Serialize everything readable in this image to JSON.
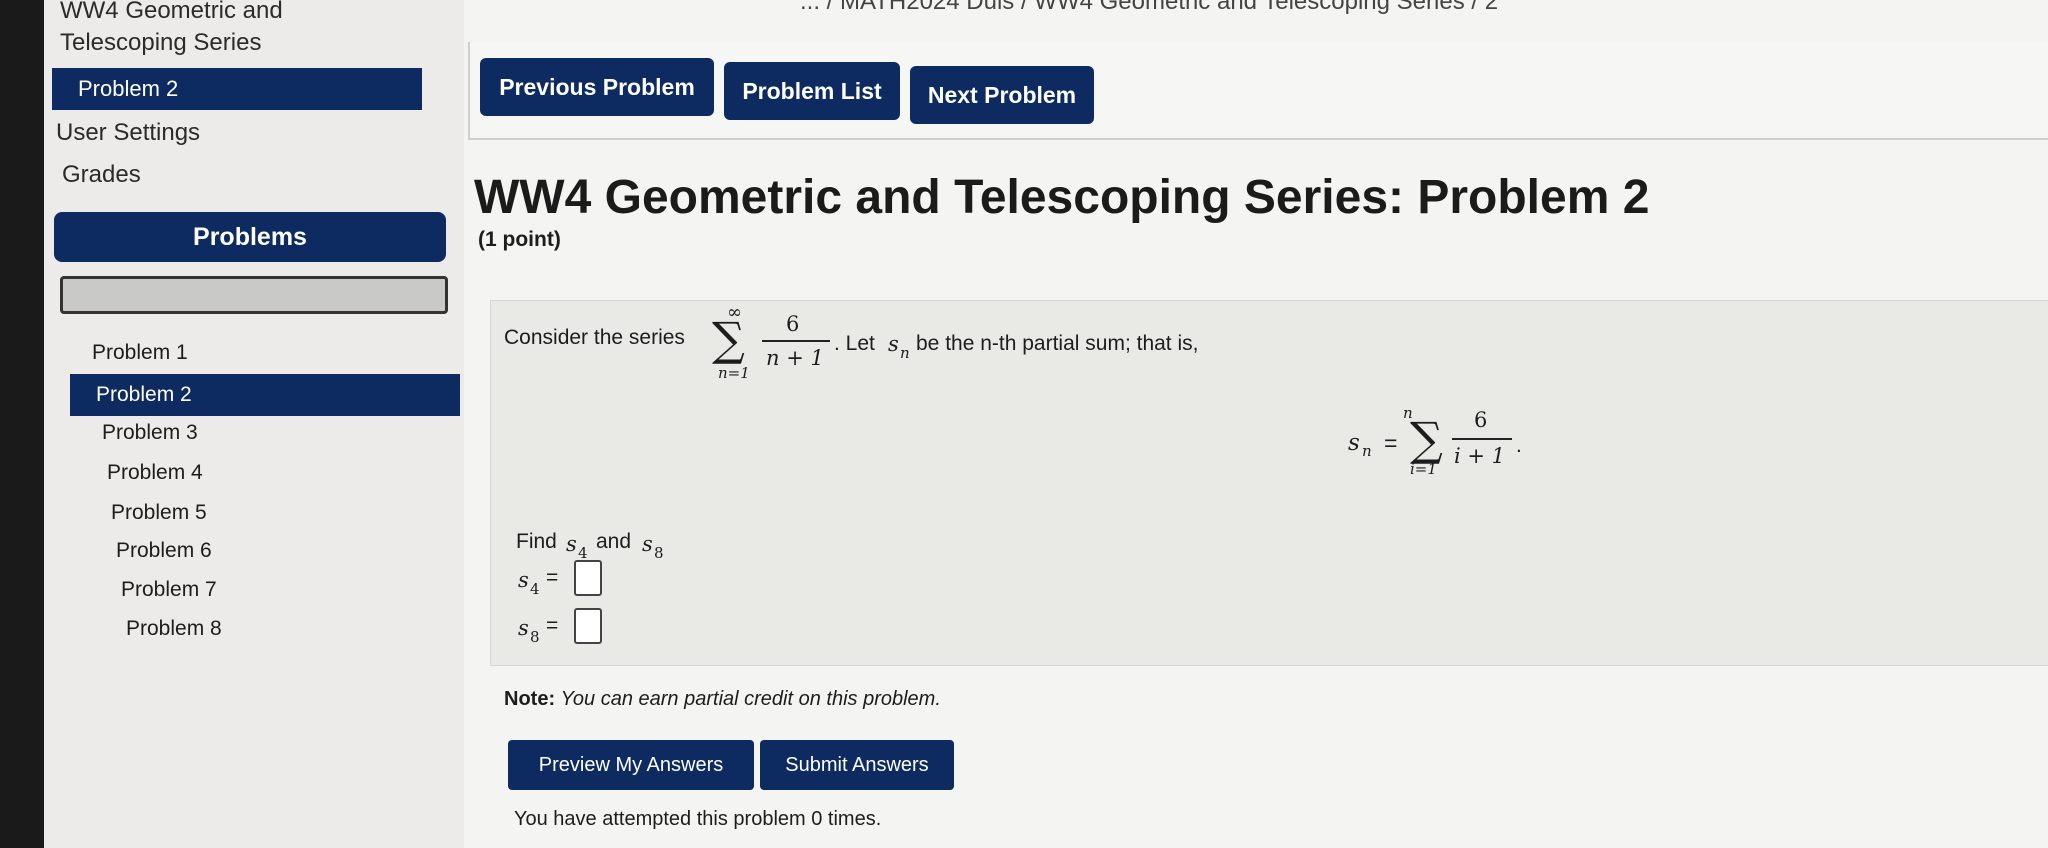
{
  "sidebar": {
    "set_title_line1": "WW4 Geometric and",
    "set_title_line2": "Telescoping Series",
    "current_problem": "Problem 2",
    "user_settings": "User Settings",
    "grades": "Grades",
    "problems_header": "Problems",
    "problem_list": [
      "Problem 1",
      "Problem 2",
      "Problem 3",
      "Problem 4",
      "Problem 5",
      "Problem 6",
      "Problem 7",
      "Problem 8"
    ],
    "active_index": 1
  },
  "breadcrumb": {
    "text": "... / MATH2024 Duis / WW4 Geometric and Telescoping Series / 2"
  },
  "nav": {
    "previous": "Previous Problem",
    "list": "Problem List",
    "next": "Next Problem"
  },
  "problem": {
    "title": "WW4 Geometric and Telescoping Series: Problem 2",
    "points": "(1 point)",
    "consider_prefix": "Consider the series",
    "numerator": "6",
    "series_denominator": "n + 1",
    "upper_limit": "∞",
    "lower_limit": "n=1",
    "let_text": ". Let",
    "s_n": "s",
    "sub_n": "n",
    "partial_sum_text": "be the n-th partial sum; that is,",
    "partial_upper": "n",
    "partial_lower": "i=1",
    "partial_denominator": "i + 1",
    "find_text": "Find",
    "find_and": "and",
    "sub_4": "4",
    "sub_8": "8",
    "equals": "="
  },
  "note": {
    "label": "Note:",
    "text": "You can earn partial credit on this problem."
  },
  "actions": {
    "preview": "Preview My Answers",
    "submit": "Submit Answers"
  },
  "attempts": "You have attempted this problem 0 times."
}
